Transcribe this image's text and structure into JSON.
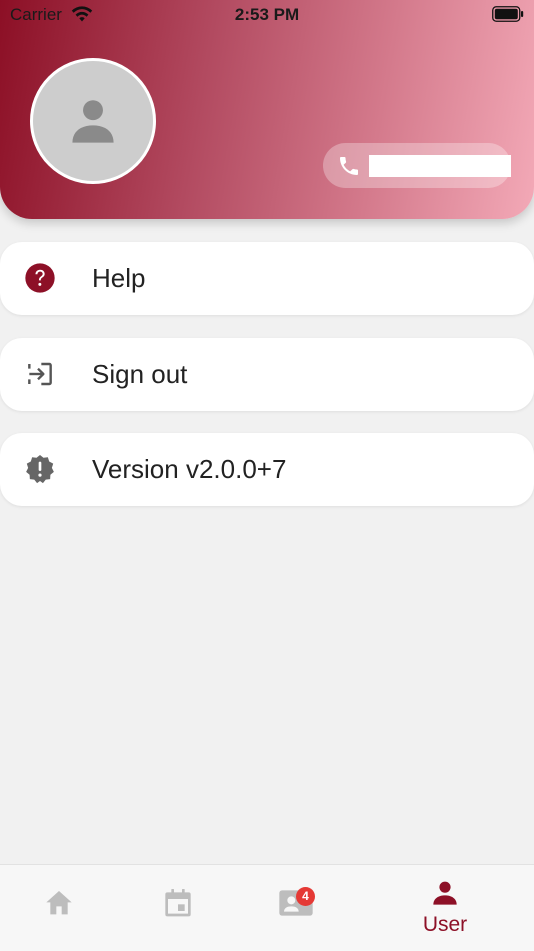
{
  "status_bar": {
    "carrier": "Carrier",
    "time": "2:53 PM",
    "wifi_icon": "wifi-icon",
    "battery_icon": "battery-icon"
  },
  "profile": {
    "avatar_icon": "person-icon",
    "phone_icon": "phone-icon",
    "phone_number": ""
  },
  "menu": {
    "items": [
      {
        "label": "Help",
        "icon": "help-circle-icon"
      },
      {
        "label": "Sign out",
        "icon": "sign-out-icon"
      },
      {
        "label": "Version v2.0.0+7",
        "icon": "verified-badge-icon"
      }
    ]
  },
  "bottom_nav": {
    "items": [
      {
        "icon": "home-icon"
      },
      {
        "icon": "calendar-icon"
      },
      {
        "icon": "contacts-icon",
        "badge": "4"
      },
      {
        "icon": "user-icon",
        "label": "User"
      }
    ]
  },
  "colors": {
    "accent": "#8d1027",
    "gradient_start": "#8c0f25",
    "gradient_end": "#f3a9b7",
    "inactive_icon": "#bdbdbd",
    "badge": "#e53935"
  }
}
